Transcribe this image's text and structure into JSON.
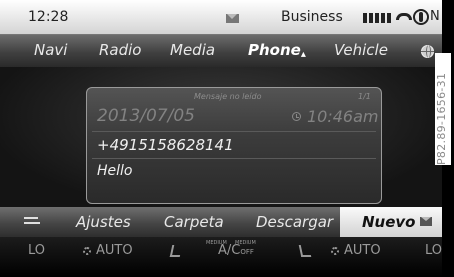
{
  "status_bar": {
    "time": "12:28",
    "profile": "Business",
    "compass_letter": "N",
    "icons": [
      "envelope-icon",
      "signal-strength-icon",
      "phone-handset-icon",
      "compass-icon"
    ]
  },
  "main_menu": {
    "items": [
      "Navi",
      "Radio",
      "Media",
      "Phone",
      "Vehicle"
    ],
    "active": "Phone",
    "globe_icon": "globe-icon"
  },
  "message": {
    "status": "Mensaje no leído",
    "counter": "1/1",
    "date": "2013/07/05",
    "time": "10:46am",
    "sender": "+4915158628141",
    "body": "Hello"
  },
  "submenu": {
    "items": [
      "Ajustes",
      "Carpeta",
      "Descargar",
      "Nuevo"
    ],
    "selected": "Nuevo"
  },
  "climate": {
    "left_temp": "LO",
    "left_fan": "AUTO",
    "mode_label_left": "MEDIUM",
    "mode_label_right": "MEDIUM",
    "ac_label": "A/C",
    "ac_suffix": "OFF",
    "right_fan": "AUTO",
    "right_temp": "LO"
  },
  "figure_id": "P82.89-1656-31",
  "colors": {
    "background": "#000000",
    "status_bar": "#e8e8e8",
    "selected_item": "#f0f0f0",
    "text_light": "#e8e8e8",
    "text_dim": "#828282"
  }
}
